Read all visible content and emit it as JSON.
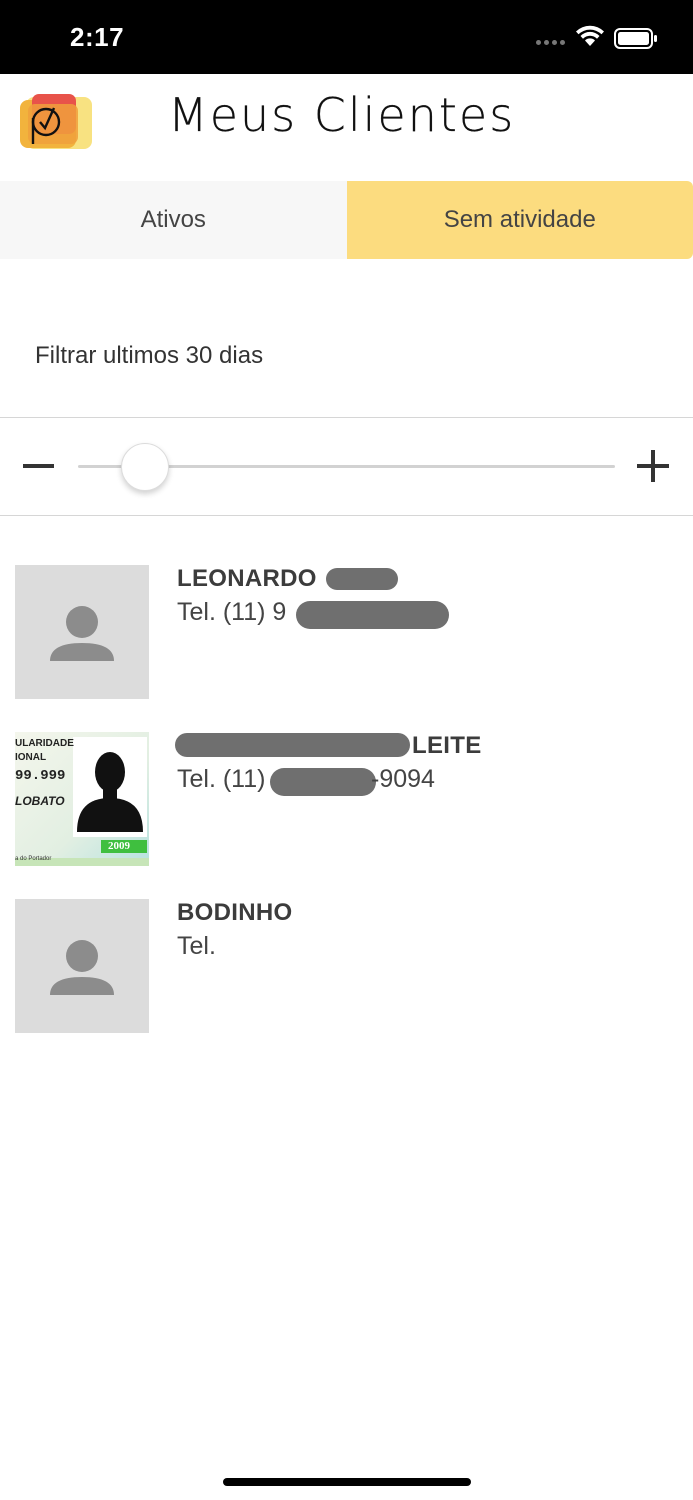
{
  "status_bar": {
    "time": "2:17"
  },
  "header": {
    "title": "Meus Clientes"
  },
  "tabs": [
    {
      "label": "Ativos",
      "selected": false
    },
    {
      "label": "Sem atividade",
      "selected": true
    }
  ],
  "filter": {
    "label": "Filtrar ultimos 30 dias"
  },
  "clients": [
    {
      "name": "LEONARDO",
      "phone": "Tel. (11) 9",
      "avatar": "placeholder-person-icon"
    },
    {
      "name": "LEITE",
      "phone_prefix": "Tel. (11)",
      "phone_suffix": "-9094",
      "avatar": "id-card-photo"
    },
    {
      "name": "BODINHO",
      "phone": "Tel.",
      "avatar": "placeholder-person-icon"
    }
  ],
  "id_card": {
    "line1": "ULARIDADE",
    "line2": "IONAL",
    "line3": "99.999",
    "line4": "LOBATO",
    "year": "2009",
    "footer": "a do Portador"
  },
  "colors": {
    "accent": "#fcdc7f",
    "tab_inactive": "#f7f7f7",
    "avatar_bg": "#dcdcdc"
  }
}
